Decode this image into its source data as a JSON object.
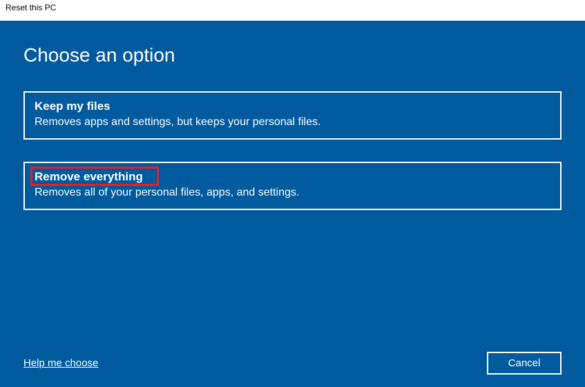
{
  "header": {
    "title": "Reset this PC"
  },
  "main": {
    "title": "Choose an option",
    "options": [
      {
        "title": "Keep my files",
        "desc": "Removes apps and settings, but keeps your personal files."
      },
      {
        "title": "Remove everything",
        "desc": "Removes all of your personal files, apps, and settings."
      }
    ]
  },
  "footer": {
    "help": "Help me choose",
    "cancel": "Cancel"
  }
}
